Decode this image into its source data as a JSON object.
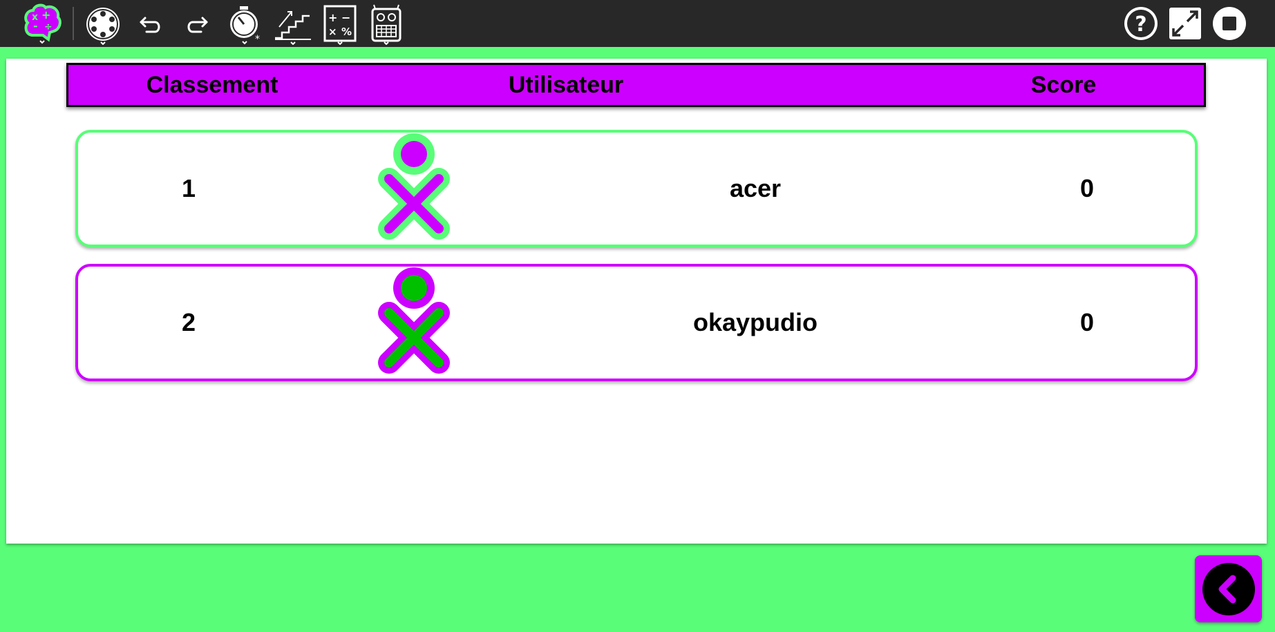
{
  "toolbar": {
    "items": [
      {
        "name": "activity-icon"
      },
      {
        "name": "network-icon"
      },
      {
        "name": "undo-icon"
      },
      {
        "name": "redo-icon"
      },
      {
        "name": "timer-icon"
      },
      {
        "name": "level-icon"
      },
      {
        "name": "operations-icon"
      },
      {
        "name": "robot-icon"
      }
    ],
    "right_items": [
      {
        "name": "help-icon"
      },
      {
        "name": "fullscreen-icon"
      },
      {
        "name": "stop-icon"
      }
    ]
  },
  "table": {
    "headers": {
      "rank": "Classement",
      "user": "Utilisateur",
      "score": "Score"
    },
    "rows": [
      {
        "rank": "1",
        "user": "acer",
        "score": "0",
        "stroke": "#59fd78",
        "fill": "#cc00ff"
      },
      {
        "rank": "2",
        "user": "okaypudio",
        "score": "0",
        "stroke": "#cc00ff",
        "fill": "#00c000"
      }
    ]
  },
  "colors": {
    "background": "#59fd78",
    "accent": "#cc00ff",
    "toolbar": "#282828"
  },
  "back_button": {
    "icon": "chevron-left-icon"
  }
}
